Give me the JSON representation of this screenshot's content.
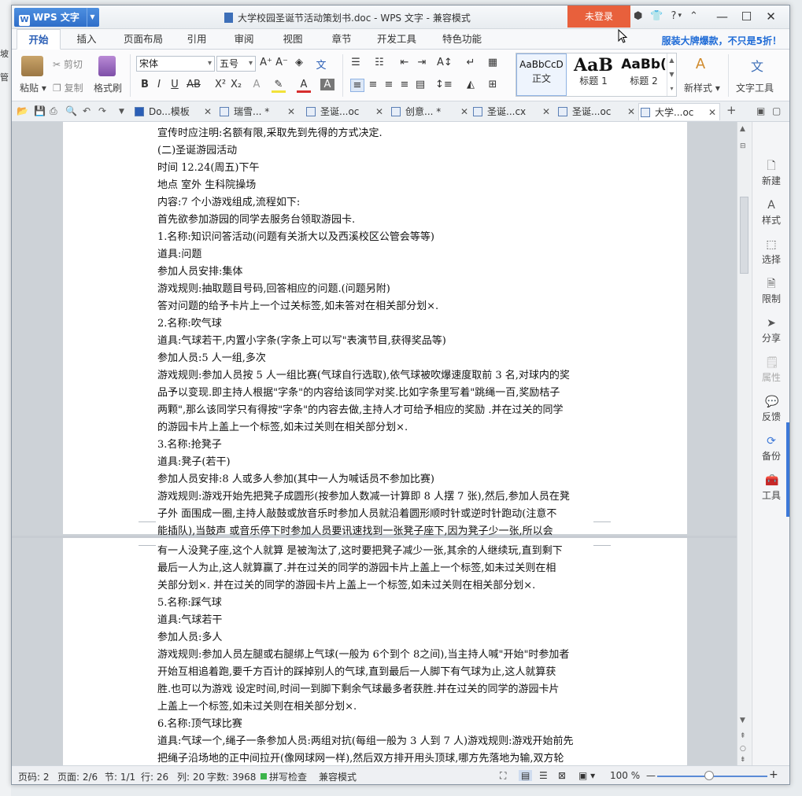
{
  "desktop_left": {
    "items": [
      "坡",
      "管"
    ]
  },
  "titlebar": {
    "app_name": "WPS 文字",
    "title": "大学校园圣诞节活动策划书.doc - WPS 文字 - 兼容模式",
    "login": "未登录",
    "help": "?"
  },
  "menu": {
    "tabs": [
      "开始",
      "插入",
      "页面布局",
      "引用",
      "审阅",
      "视图",
      "章节",
      "开发工具",
      "特色功能"
    ],
    "promo": "服装大牌爆款，不只是5折！"
  },
  "ribbon": {
    "paste": "粘贴",
    "cut": "剪切",
    "copy": "复制",
    "format_painter": "格式刷",
    "font_name": "宋体",
    "font_size": "五号",
    "styles": [
      {
        "preview": "AaBbCcD",
        "name": "正文"
      },
      {
        "preview": "AaB",
        "name": "标题 1"
      },
      {
        "preview": "AaBb(",
        "name": "标题 2"
      }
    ],
    "new_style": "新样式",
    "text_tools": "文字工具"
  },
  "doc_tabs": [
    "Do...模板",
    "瑞雪... *",
    "圣诞...oc",
    "创意... *",
    "圣诞...cx",
    "圣诞...oc",
    "大学...oc"
  ],
  "document": {
    "page1_lines": [
      "宣传时应注明:名额有限,采取先到先得的方式决定.",
      "(二)圣诞游园活动",
      "时间  12.24(周五)下午",
      "地点  室外  生科院操场",
      "内容:7 个小游戏组成,流程如下:",
      "首先欲参加游园的同学去服务台领取游园卡.",
      "1.名称:知识问答活动(问题有关浙大以及西溪校区公管会等等)",
      "道具:问题",
      "参加人员安排:集体",
      "游戏规则:抽取题目号码,回答相应的问题.(问题另附)",
      "答对问题的给予卡片上一个过关标签,如未答对在相关部分划×.",
      "2.名称:吹气球",
      "道具:气球若干,内置小字条(字条上可以写\"表演节目,获得奖品等)",
      "参加人员:5 人一组,多次",
      "游戏规则:参加人员按 5 人一组比赛(气球自行选取),依气球被吹爆速度取前 3 名,对球内的奖",
      "品予以变现.即主持人根据\"字条\"的内容给该同学对奖.比如字条里写着\"跳绳一百,奖励桔子",
      "两颗\",那么该同学只有得按\"字条\"的内容去做,主持人才可给予相应的奖励 .并在过关的同学",
      "的游园卡片上盖上一个标签,如未过关则在相关部分划×.",
      "3.名称:抢凳子",
      "道具:凳子(若干)",
      "参加人员安排:8 人或多人参加(其中一人为喊话员不参加比赛)",
      "游戏规则:游戏开始先把凳子成圆形(按参加人数减一计算即 8 人摆 7 张),然后,参加人员在凳",
      "子外  面围成一圈,主持人敲鼓或放音乐时参加人员就沿着圆形顺时针或逆时针跑动(注意不",
      "能插队),当鼓声  或音乐停下时参加人员要讯速找到一张凳子座下,因为凳子少一张,所以会"
    ],
    "page2_lines": [
      "有一人没凳子座,这个人就算  是被淘汰了,这时要把凳子减少一张,其余的人继续玩,直到剩下",
      "最后一人为止,这人就算赢了.并在过关的同学的游园卡片上盖上一个标签,如未过关则在相",
      "关部分划×. 并在过关的同学的游园卡片上盖上一个标签,如未过关则在相关部分划×.",
      "5.名称:踩气球",
      "道具:气球若干",
      "参加人员:多人",
      "游戏规则:参加人员左腿或右腿绑上气球(一般为 6个到个 8之间),当主持人喊\"开始\"时参加者",
      "开始互相追着跑,要千方百计的踩掉别人的气球,直到最后一人脚下有气球为止,这人就算获",
      "胜.也可以为游戏  设定时间,时间一到脚下剩余气球最多者获胜.并在过关的同学的游园卡片",
      "上盖上一个标签,如未过关则在相关部分划×.",
      "6.名称:顶气球比赛",
      "道具:气球一个,绳子一条参加人员:两组对抗(每组一般为 3 人到 7 人)游戏规则:游戏开始前先",
      "把绳子沿场地的正中间拉开(像网球网一样),然后双方排开用头顶球,哪方先落地为输,双方轮"
    ]
  },
  "side_panel": [
    {
      "icon": "new-icon",
      "label": "新建"
    },
    {
      "icon": "style-icon",
      "label": "样式"
    },
    {
      "icon": "select-icon",
      "label": "选择"
    },
    {
      "icon": "restrict-icon",
      "label": "限制"
    },
    {
      "icon": "share-icon",
      "label": "分享"
    },
    {
      "icon": "properties-icon",
      "label": "属性"
    },
    {
      "icon": "feedback-icon",
      "label": "反馈"
    },
    {
      "icon": "backup-icon",
      "label": "备份"
    },
    {
      "icon": "tools-icon",
      "label": "工具"
    }
  ],
  "status": {
    "page_code": "页码: 2",
    "pages": "页面: 2/6",
    "section": "节: 1/1",
    "row": "行: 26",
    "col": "列: 20",
    "word_count": "字数: 3968",
    "spell_check": "拼写检查",
    "compat": "兼容模式",
    "zoom": "100 %"
  },
  "colors": {
    "accent": "#2b5fb6",
    "login_bg": "#e8603c",
    "app_btn": "#2f6ec9"
  }
}
